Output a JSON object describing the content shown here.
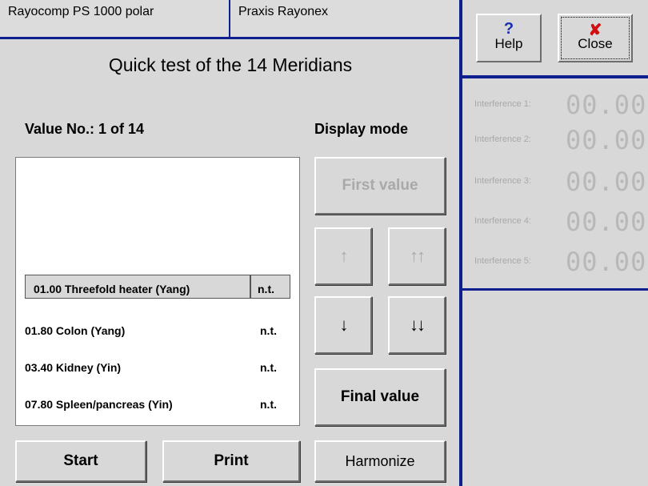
{
  "header": {
    "device_tab": "Rayocomp PS 1000 polar",
    "practice_tab": "Praxis Rayonex"
  },
  "main": {
    "title": "Quick test of the 14 Meridians",
    "value_counter": "Value No.: 1 of 14",
    "display_mode_label": "Display mode"
  },
  "list": {
    "rows": [
      {
        "name": "01.00 Threefold heater (Yang)",
        "value": "n.t.",
        "selected": true
      },
      {
        "name": "01.80 Colon (Yang)",
        "value": "n.t."
      },
      {
        "name": "03.40 Kidney (Yin)",
        "value": "n.t."
      },
      {
        "name": "07.80 Spleen/pancreas (Yin)",
        "value": "n.t."
      }
    ]
  },
  "navigation": {
    "first_value": "First value",
    "up_icon": "arrow-up-icon",
    "up_fast_icon": "double-arrow-up-icon",
    "down_icon": "arrow-down-icon",
    "down_fast_icon": "double-arrow-down-icon",
    "final_value": "Final value"
  },
  "bottom": {
    "start": "Start",
    "print": "Print",
    "harmonize": "Harmonize"
  },
  "side": {
    "help_label": "Help",
    "help_icon": "question-icon",
    "help_color": "#1a2fb0",
    "close_label": "Close",
    "close_icon": "close-x-icon",
    "close_color": "#d01010",
    "interferences": [
      {
        "label": "Interference 1:",
        "value": "00.00"
      },
      {
        "label": "Interference 2:",
        "value": "00.00"
      },
      {
        "label": "Interference 3:",
        "value": "00.00"
      },
      {
        "label": "Interference 4:",
        "value": "00.00"
      },
      {
        "label": "Interference 5:",
        "value": "00.00"
      }
    ]
  },
  "colors": {
    "divider": "#0f1f8f",
    "background": "#d8d8d8",
    "disabled_text": "#a9a9a9"
  }
}
